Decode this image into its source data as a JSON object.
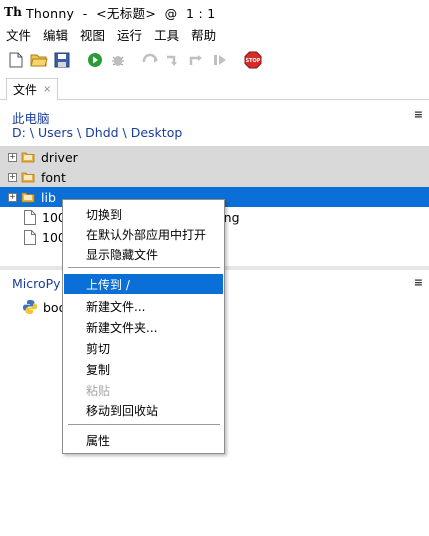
{
  "window": {
    "title": "Thonny  -  <无标题>  @  1 : 1",
    "logo": "Th"
  },
  "menubar": [
    "文件",
    "编辑",
    "视图",
    "运行",
    "工具",
    "帮助"
  ],
  "toolbar": {
    "icons": [
      "new-file-icon",
      "open-file-icon",
      "save-icon",
      "run-icon",
      "debug-icon",
      "step-over-icon",
      "step-into-icon",
      "step-out-icon",
      "resume-icon",
      "stop-icon"
    ],
    "stop_label": "STOP"
  },
  "tab": {
    "label": "文件",
    "close": "×"
  },
  "files": {
    "location_title": "此电脑",
    "path": "D: \\ Users \\ Dhdd \\ Desktop",
    "menu_glyph": "≡",
    "tree": [
      {
        "label": "driver",
        "type": "folder"
      },
      {
        "label": "font",
        "type": "folder"
      },
      {
        "label": "lib",
        "type": "folder",
        "selected": true
      },
      {
        "label": "100",
        "type": "file",
        "suffix": "ong"
      },
      {
        "label": "100",
        "type": "file"
      }
    ]
  },
  "micropython": {
    "title": "MicroPy",
    "menu_glyph": "≡",
    "item": "boo"
  },
  "context_menu": {
    "items": [
      {
        "label": "切换到",
        "state": "normal"
      },
      {
        "label": "在默认外部应用中打开",
        "state": "normal"
      },
      {
        "label": "显示隐藏文件",
        "state": "normal"
      },
      {
        "label": "上传到 /",
        "state": "active"
      },
      {
        "label": "新建文件...",
        "state": "normal"
      },
      {
        "label": "新建文件夹...",
        "state": "normal"
      },
      {
        "label": "剪切",
        "state": "normal"
      },
      {
        "label": "复制",
        "state": "normal"
      },
      {
        "label": "粘贴",
        "state": "disabled"
      },
      {
        "label": "移动到回收站",
        "state": "normal"
      },
      {
        "label": "属性",
        "state": "normal"
      }
    ]
  },
  "colors": {
    "accent": "#0a6fd6",
    "link": "#1a3d9c",
    "dir_row": "#d9d9d9"
  }
}
